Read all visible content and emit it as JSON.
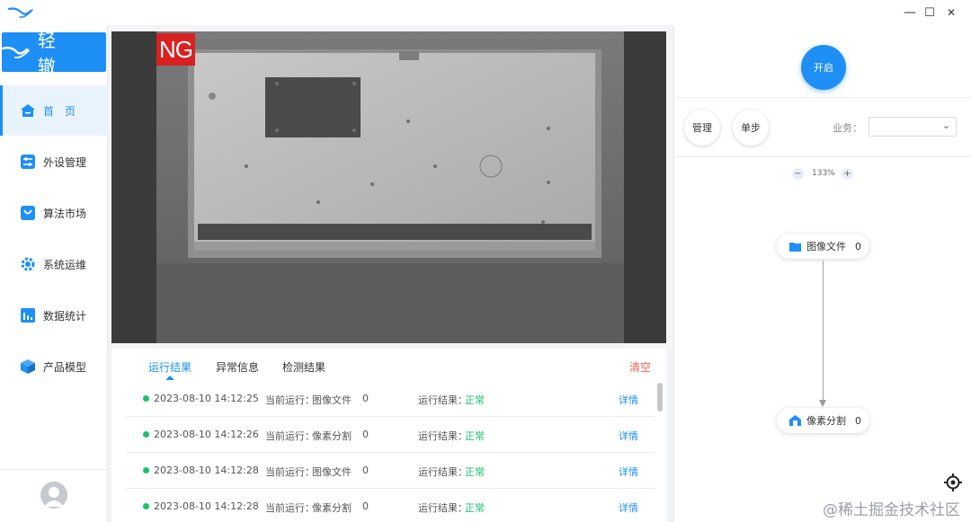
{
  "window": {
    "minimize": "—",
    "maximize": "☐",
    "close": "✕"
  },
  "brand": {
    "name": "轻 辙"
  },
  "sidebar": {
    "items": [
      {
        "label": "首　页",
        "icon": "home-icon",
        "active": true
      },
      {
        "label": "外设管理",
        "icon": "peripheral-icon"
      },
      {
        "label": "算法市场",
        "icon": "market-icon"
      },
      {
        "label": "系统运维",
        "icon": "gear-icon"
      },
      {
        "label": "数据统计",
        "icon": "bar-chart-icon"
      },
      {
        "label": "产品模型",
        "icon": "cube-icon"
      }
    ]
  },
  "viewport": {
    "badge": "NG"
  },
  "results": {
    "tabs": [
      "运行结果",
      "异常信息",
      "检测结果"
    ],
    "clear": "清空",
    "rows": [
      {
        "time": "2023-08-10 14:12:25",
        "current_label": "当前运行：",
        "current_value": "图像文件",
        "count": "0",
        "result_label": "运行结果：",
        "result_value": "正常",
        "detail": "详情"
      },
      {
        "time": "2023-08-10 14:12:26",
        "current_label": "当前运行：",
        "current_value": "像素分割",
        "count": "0",
        "result_label": "运行结果：",
        "result_value": "正常",
        "detail": "详情"
      },
      {
        "time": "2023-08-10 14:12:28",
        "current_label": "当前运行：",
        "current_value": "图像文件",
        "count": "0",
        "result_label": "运行结果：",
        "result_value": "正常",
        "detail": "详情"
      },
      {
        "time": "2023-08-10 14:12:28",
        "current_label": "当前运行：",
        "current_value": "像素分割",
        "count": "0",
        "result_label": "运行结果：",
        "result_value": "正常",
        "detail": "详情"
      }
    ]
  },
  "right_panel": {
    "start": "开启",
    "manage": "管理",
    "step": "单步",
    "business_label": "业务：",
    "business_value": "",
    "zoom": "133%",
    "zoom_out": "−",
    "zoom_in": "+",
    "nodes": [
      {
        "label": "图像文件",
        "count": "0",
        "icon": "folder-icon"
      },
      {
        "label": "像素分割",
        "count": "0",
        "icon": "segmentation-icon"
      }
    ]
  },
  "watermark": "@稀土掘金技术社区",
  "colors": {
    "accent": "#1e8ff4",
    "ok": "#1cc06e",
    "ng": "#d92121",
    "clear": "#f0605a"
  }
}
